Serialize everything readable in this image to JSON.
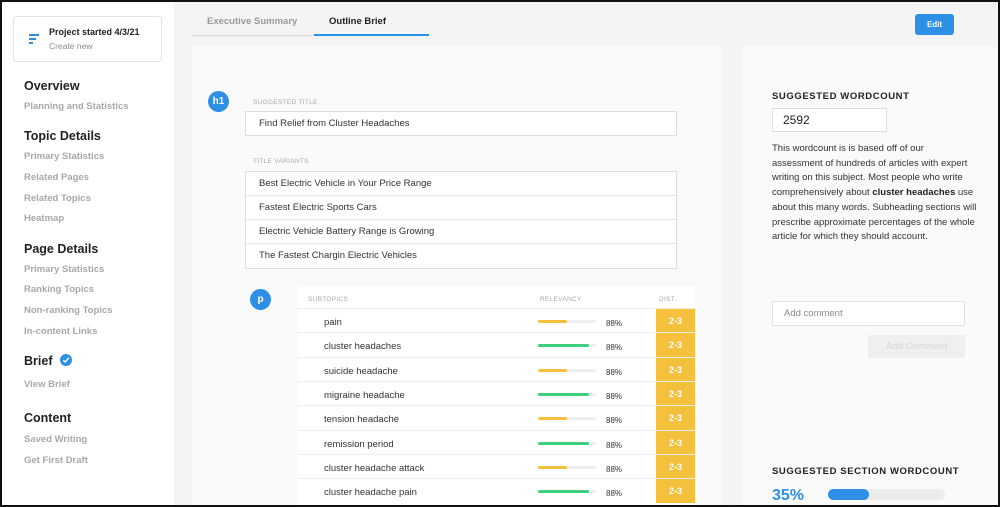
{
  "sidebar": {
    "project_title": "Project started 4/3/21",
    "project_sub": "Create new",
    "sections": [
      {
        "heading": "Overview",
        "items": [
          "Planning and Statistics"
        ]
      },
      {
        "heading": "Topic Details",
        "items": [
          "Primary Statistics",
          "Related Pages",
          "Related Topics",
          "Heatmap"
        ]
      },
      {
        "heading": "Page Details",
        "items": [
          "Primary Statistics",
          "Ranking Topics",
          "Non-ranking Topics",
          "In-content Links"
        ]
      },
      {
        "heading": "Brief",
        "items": [
          "View Brief"
        ]
      },
      {
        "heading": "Content",
        "items": [
          "Saved Writing",
          "Get First Draft"
        ]
      }
    ]
  },
  "tabs": {
    "executive": "Executive Summary",
    "outline": "Outline Brief"
  },
  "edit_label": "Edit",
  "outline": {
    "h1_badge": "h1",
    "p_badge": "p",
    "suggested_title_label": "SUGGESTED TITLE",
    "suggested_title": "Find Relief from Cluster Headaches",
    "variants_label": "TITLE VARIANTS",
    "variants": [
      "Best Electric Vehicle in Your Price Range",
      "Fastest Electric Sports Cars",
      "Electric Vehicle Battery Range is Growing",
      "The Fastest Chargin Electric Vehicles"
    ],
    "columns": {
      "subtopics": "SUBTOPICS",
      "relevancy": "RELEVANCY",
      "dist": "DIST."
    },
    "subtopics": [
      {
        "name": "pain",
        "relevancy": 0.5,
        "color": "#f5c13d",
        "pct": "88%",
        "dist": "2-3"
      },
      {
        "name": "cluster headaches",
        "relevancy": 0.88,
        "color": "#3ccf7d",
        "pct": "88%",
        "dist": "2-3"
      },
      {
        "name": "suicide headache",
        "relevancy": 0.5,
        "color": "#f5c13d",
        "pct": "88%",
        "dist": "2-3"
      },
      {
        "name": "migraine headache",
        "relevancy": 0.88,
        "color": "#3ccf7d",
        "pct": "88%",
        "dist": "2-3"
      },
      {
        "name": "tension headache",
        "relevancy": 0.5,
        "color": "#f5c13d",
        "pct": "88%",
        "dist": "2-3"
      },
      {
        "name": "remission period",
        "relevancy": 0.88,
        "color": "#3ccf7d",
        "pct": "88%",
        "dist": "2-3"
      },
      {
        "name": "cluster headache attack",
        "relevancy": 0.5,
        "color": "#f5c13d",
        "pct": "88%",
        "dist": "2-3"
      },
      {
        "name": "cluster headache pain",
        "relevancy": 0.88,
        "color": "#3ccf7d",
        "pct": "88%",
        "dist": "2-3"
      }
    ]
  },
  "right": {
    "wordcount_title": "SUGGESTED WORDCOUNT",
    "wordcount": "2592",
    "desc_before": "This wordcount is is based off of our assessment of hundreds of articles with expert writing on this subject. Most people who write comprehensively about ",
    "desc_bold": "cluster headaches",
    "desc_after": " use about this many words. Subheading sections will prescribe approximate percentages of the whole article for which they should account.",
    "comment_placeholder": "Add comment",
    "add_comment_label": "Add Comment",
    "section_title": "SUGGESTED SECTION WORDCOUNT",
    "section_pct": "35%",
    "section_fraction": 0.35
  },
  "colors": {
    "accent": "#2d8fe6",
    "dist": "#f5c13d",
    "green": "#3ccf7d",
    "yellow": "#f5c13d"
  },
  "icons": {
    "project": "menu-lines-icon",
    "brief_status": "check-circle-icon"
  }
}
